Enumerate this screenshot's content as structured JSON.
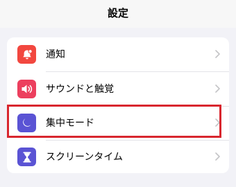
{
  "header": {
    "title": "設定"
  },
  "settings": {
    "items": [
      {
        "label": "通知",
        "icon": "bell-badge-icon",
        "color": "#f2473f"
      },
      {
        "label": "サウンドと触覚",
        "icon": "speaker-wave-icon",
        "color": "#ec3f5e"
      },
      {
        "label": "集中モード",
        "icon": "moon-icon",
        "color": "#5a53d4"
      },
      {
        "label": "スクリーンタイム",
        "icon": "hourglass-icon",
        "color": "#5a53d4"
      }
    ]
  },
  "highlight": {
    "target": "集中モード",
    "color": "#d8262e"
  }
}
